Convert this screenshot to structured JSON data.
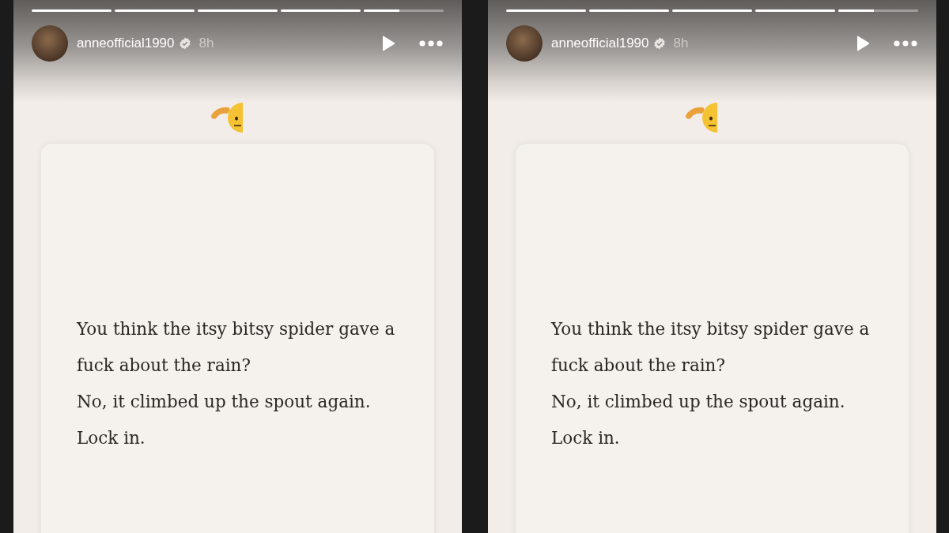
{
  "stories": [
    {
      "segments": [
        {
          "level": 1
        },
        {
          "level": 1
        },
        {
          "level": 1
        },
        {
          "level": 1
        },
        {
          "level": 0.45
        }
      ],
      "username": "anneofficial1990",
      "verified": true,
      "time": "8h",
      "lines": [
        "You think the itsy bitsy spider gave a",
        "fuck about the rain?",
        "No, it climbed up the spout again.",
        "Lock in."
      ]
    },
    {
      "segments": [
        {
          "level": 1
        },
        {
          "level": 1
        },
        {
          "level": 1
        },
        {
          "level": 1
        },
        {
          "level": 0.45
        }
      ],
      "username": "anneofficial1990",
      "verified": true,
      "time": "8h",
      "lines": [
        "You think the itsy bitsy spider gave a",
        "fuck about the rain?",
        "No, it climbed up the spout again.",
        "Lock in."
      ]
    }
  ]
}
